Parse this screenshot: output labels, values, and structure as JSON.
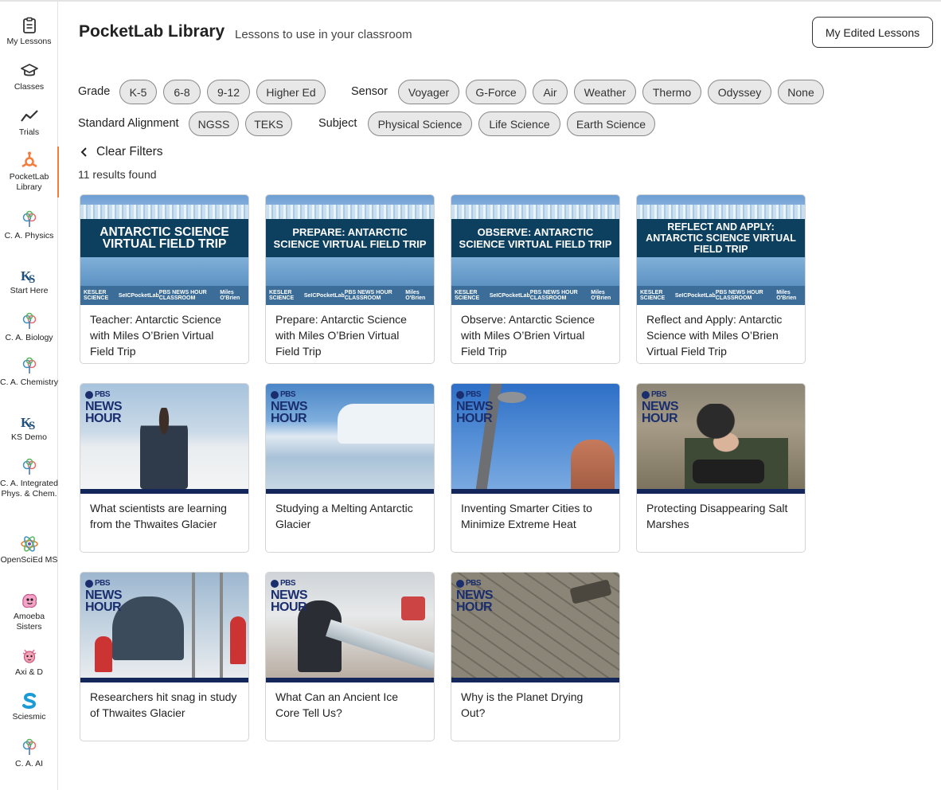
{
  "sidebar": {
    "items": [
      {
        "label": "My Lessons",
        "icon": "clipboard-icon"
      },
      {
        "label": "Classes",
        "icon": "graduation-cap-icon"
      },
      {
        "label": "Trials",
        "icon": "line-graph-icon"
      },
      {
        "label": "PocketLab Library",
        "icon": "pocketlab-library-icon"
      },
      {
        "label": "C. A. Physics",
        "icon": "tree-icon"
      },
      {
        "label": "Start Here",
        "icon": "ks-logo-icon"
      },
      {
        "label": "C. A. Biology",
        "icon": "tree-icon"
      },
      {
        "label": "C. A. Chemistry",
        "icon": "tree-icon"
      },
      {
        "label": "KS Demo",
        "icon": "ks-logo-icon"
      },
      {
        "label": "C. A. Integrated Phys. & Chem.",
        "icon": "tree-icon"
      },
      {
        "label": "OpenSciEd MS",
        "icon": "atom-icon"
      },
      {
        "label": "Amoeba Sisters",
        "icon": "amoeba-icon"
      },
      {
        "label": "Axi & D",
        "icon": "axolotl-icon"
      },
      {
        "label": "Sciesmic",
        "icon": "sciesmic-s-icon"
      },
      {
        "label": "C. A. AI",
        "icon": "tree-icon"
      }
    ],
    "active_color": "#f47c3c"
  },
  "header": {
    "title": "PocketLab Library",
    "subtitle": "Lessons to use in your classroom",
    "edited_button": "My Edited Lessons"
  },
  "filters": {
    "grade_label": "Grade",
    "grade": [
      "K-5",
      "6-8",
      "9-12",
      "Higher Ed"
    ],
    "sensor_label": "Sensor",
    "sensor": [
      "Voyager",
      "G-Force",
      "Air",
      "Weather",
      "Thermo",
      "Odyssey",
      "None"
    ],
    "standard_label": "Standard Alignment",
    "standard": [
      "NGSS",
      "TEKS"
    ],
    "subject_label": "Subject",
    "subject": [
      "Physical Science",
      "Life Science",
      "Earth Science"
    ],
    "clear_label": "Clear Filters",
    "results": "11 results found"
  },
  "cards": [
    {
      "title": "Teacher: Antarctic Science with Miles O’Brien Virtual Field Trip",
      "thumb": "ANTARCTIC SCIENCE VIRTUAL FIELD TRIP"
    },
    {
      "title": "Prepare: Antarctic Science with Miles O’Brien Virtual Field Trip",
      "thumb": "PREPARE: ANTARCTIC SCIENCE VIRTUAL FIELD TRIP"
    },
    {
      "title": "Observe: Antarctic Science with Miles O’Brien Virtual Field Trip",
      "thumb": "OBSERVE: ANTARCTIC SCIENCE VIRTUAL FIELD TRIP"
    },
    {
      "title": "Reflect and Apply: Antarctic Science with Miles O’Brien Virtual Field Trip",
      "thumb": "REFLECT AND APPLY: ANTARCTIC SCIENCE VIRTUAL FIELD TRIP"
    },
    {
      "title": "What scientists are learning from the Thwaites Glacier"
    },
    {
      "title": "Studying a Melting Antarctic Glacier"
    },
    {
      "title": "Inventing Smarter Cities to Minimize Extreme Heat"
    },
    {
      "title": "Protecting Disappearing Salt Marshes"
    },
    {
      "title": "Researchers hit snag in study of Thwaites Glacier"
    },
    {
      "title": "What Can an Ancient Ice Core Tell Us?"
    },
    {
      "title": "Why is the Planet Drying Out?"
    }
  ],
  "thumb_logos": {
    "kesler": "KESLER SCIENCE",
    "seic": "SeIC",
    "pocketlab": "PocketLab",
    "pbs_classroom": "PBS NEWS HOUR CLASSROOM",
    "miles": "Miles O'Brien",
    "pbs_small": "PBS",
    "news": "NEWS",
    "hour": "HOUR"
  }
}
